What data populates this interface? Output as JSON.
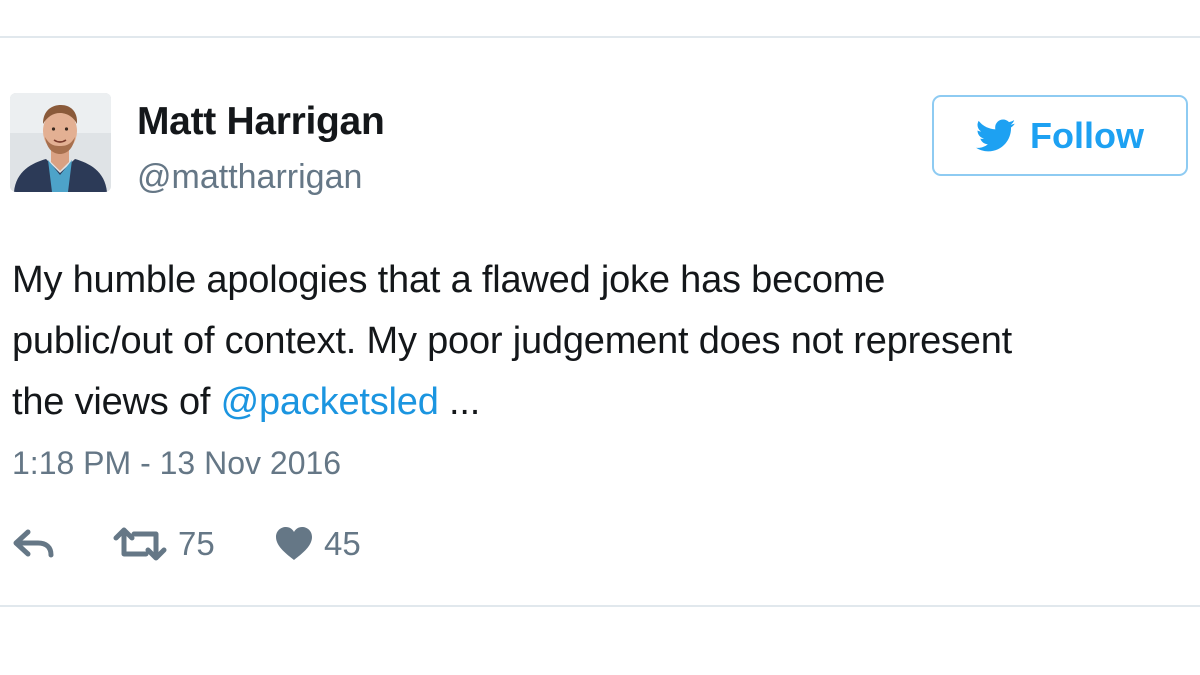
{
  "tweet": {
    "author": {
      "name": "Matt Harrigan",
      "handle": "@mattharrigan",
      "avatar_icon": "profile-photo"
    },
    "follow_button": {
      "label": "Follow",
      "icon": "twitter-bird-icon",
      "color": "#1da1f2",
      "border_color": "#8ecbf2"
    },
    "text": {
      "line1": "My humble apologies that a flawed joke has become",
      "line2": "public/out of context. My poor judgement does not represent",
      "line3_prefix": "the views of ",
      "mention": "@packetsled",
      "line3_suffix": " ..."
    },
    "timestamp": "1:18 PM - 13 Nov 2016",
    "actions": {
      "reply_icon": "reply-icon",
      "retweet_icon": "retweet-icon",
      "retweet_count": "75",
      "like_icon": "heart-icon",
      "like_count": "45"
    }
  },
  "colors": {
    "text": "#14171a",
    "secondary": "#657786",
    "link": "#1b95e0",
    "divider": "#e1e8ed"
  }
}
